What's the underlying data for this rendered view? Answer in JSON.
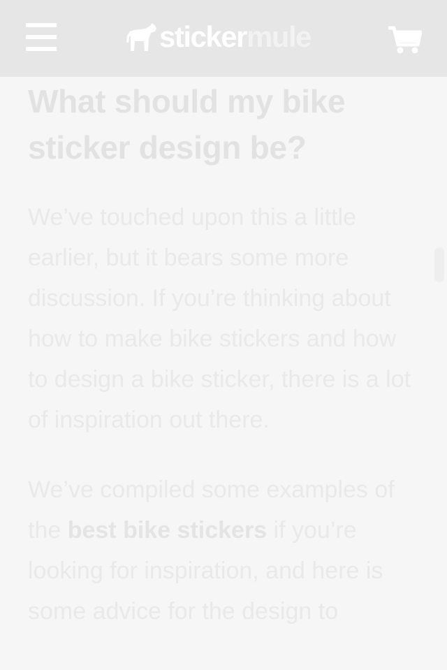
{
  "header": {
    "logo_text_1": "sticker",
    "logo_text_2": "mule"
  },
  "article": {
    "heading": "What should my bike sticker design be?",
    "para1": "We’ve touched upon this a little earlier, but it bears some more discussion. If you’re thinking about how to make bike stickers and how to design a bike sticker, there is a lot of inspiration out there.",
    "para2_before": "We’ve compiled some examples of the ",
    "para2_link": "best bike stickers",
    "para2_after": " if you’re looking for inspiration, and here is some advice for the design to"
  },
  "icons": {
    "menu": "hamburger-menu-icon",
    "logo": "mule-icon",
    "cart": "shopping-cart-icon"
  },
  "colors": {
    "header_bg": "#e6e6e6",
    "page_bg": "#f6f6f6",
    "text": "#e9e9e9"
  }
}
